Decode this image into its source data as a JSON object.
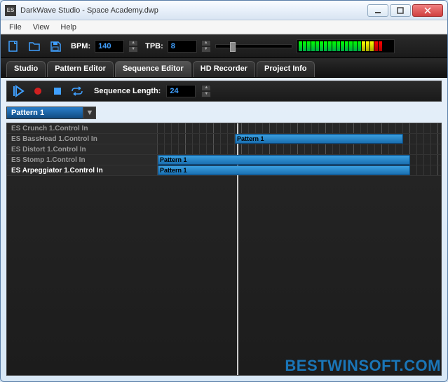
{
  "window": {
    "app_icon": "ES",
    "title": "DarkWave Studio - Space Academy.dwp"
  },
  "menu": [
    "File",
    "View",
    "Help"
  ],
  "toolbar": {
    "bpm_label": "BPM:",
    "bpm_value": "140",
    "tpb_label": "TPB:",
    "tpb_value": "8"
  },
  "tabs": [
    "Studio",
    "Pattern Editor",
    "Sequence Editor",
    "HD Recorder",
    "Project Info"
  ],
  "active_tab": 2,
  "editor": {
    "seq_len_label": "Sequence Length:",
    "seq_len_value": "24",
    "pattern_selected": "Pattern 1"
  },
  "tracks": [
    {
      "label": "ES Crunch 1.Control In",
      "clips": []
    },
    {
      "label": "ES BassHead 1.Control In",
      "clips": [
        {
          "start": 11,
          "len": 24,
          "name": "Pattern 1"
        }
      ]
    },
    {
      "label": "ES Distort 1.Control In",
      "clips": []
    },
    {
      "label": "ES Stomp 1.Control In",
      "clips": [
        {
          "start": 0,
          "len": 36,
          "name": "Pattern 1"
        }
      ]
    },
    {
      "label": "ES Arpeggiator 1.Control In",
      "clips": [
        {
          "start": 0,
          "len": 36,
          "name": "Pattern 1"
        }
      ]
    }
  ],
  "watermark": "BESTWINSOFT.COM"
}
